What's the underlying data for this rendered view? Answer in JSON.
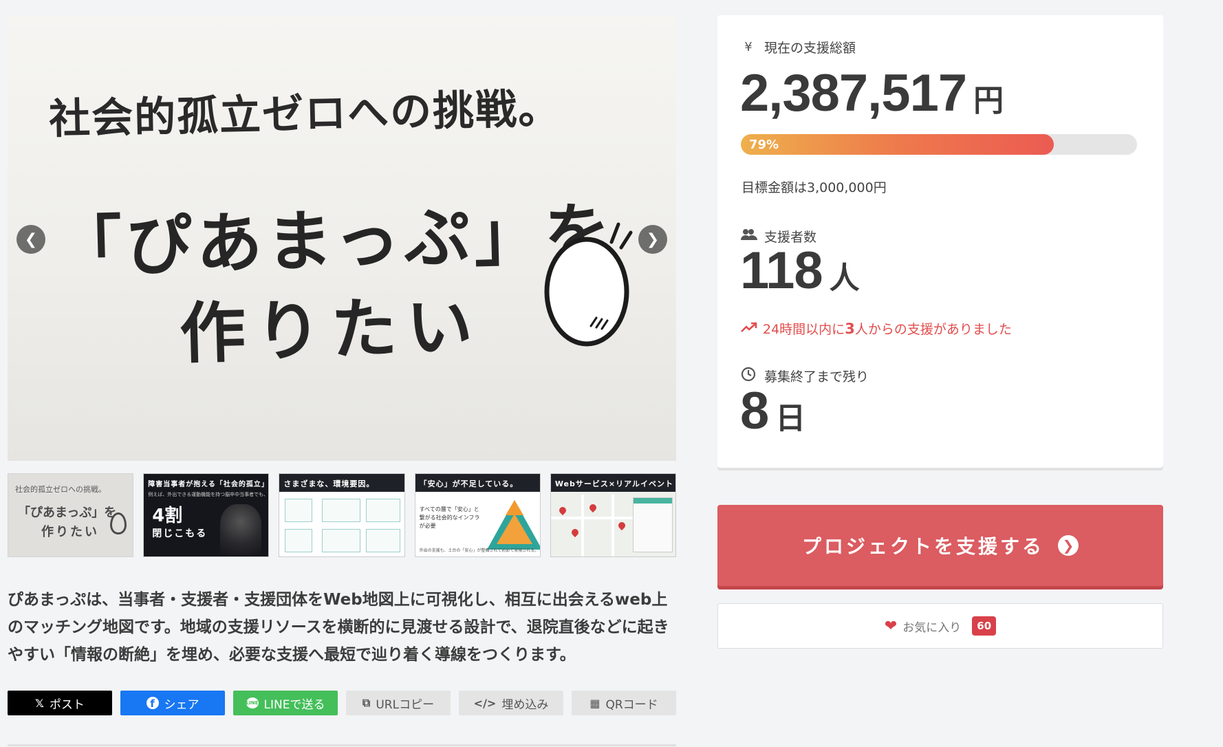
{
  "hero": {
    "line1": "社会的孤立ゼロへの挑戦。",
    "line2": "「ぴあまっぷ」を",
    "line3": "作りたい",
    "prev_icon": "chevron-left-icon",
    "next_icon": "chevron-right-icon"
  },
  "thumbnails": [
    {
      "small": "社会的孤立ゼロへの挑戦。",
      "big1": "「ぴあまっぷ」を",
      "big2": "作りたい"
    },
    {
      "title": "障害当事者が抱える「社会的孤立」",
      "sub": "例えば、外出できる運動機能を持つ脳卒中当事者でも、",
      "big": "4割",
      "mid": "閉じこもる"
    },
    {
      "title": "さまざまな、環境要因。"
    },
    {
      "title": "「安心」が不足している。",
      "text": "すべての層で「安心」と繋がる社会的なインフラが必要",
      "foot": "外出の支援も、土台の「安心」が整備されて初めて実現される。"
    },
    {
      "title": "Webサービス×リアルイベント"
    }
  ],
  "description": "ぴあまっぷは、当事者・支援者・支援団体をWeb地図上に可視化し、相互に出会えるweb上のマッチング地図です。地域の支援リソースを横断的に見渡せる設計で、退院直後などに起きやすい「情報の断絶」を埋め、必要な支援へ最短で辿り着く導線をつくります。",
  "share": {
    "post": "ポスト",
    "facebook": "シェア",
    "line": "LINEで送る",
    "url_copy": "URLコピー",
    "embed": "埋め込み",
    "qr": "QRコード"
  },
  "stats": {
    "total_label": "現在の支援総額",
    "total_value": "2,387,517",
    "total_unit": "円",
    "progress_text": "79%",
    "progress_fraction": 0.79,
    "goal_text": "目標金額は3,000,000円",
    "supporters_label": "支援者数",
    "supporters_value": "118",
    "supporters_unit": "人",
    "recent_prefix": "24時間以内に",
    "recent_count": "3",
    "recent_suffix": "人からの支援がありました",
    "remaining_label": "募集終了まで残り",
    "remaining_value": "8",
    "remaining_unit": "日"
  },
  "cta": {
    "support_label": "プロジェクトを支援する",
    "favorite_label": "お気に入り",
    "favorite_count": "60"
  },
  "colors": {
    "accent_red": "#db5c61",
    "progress_start": "#eeb04c",
    "progress_end": "#eb5b52",
    "recent_text": "#e34d4d"
  }
}
